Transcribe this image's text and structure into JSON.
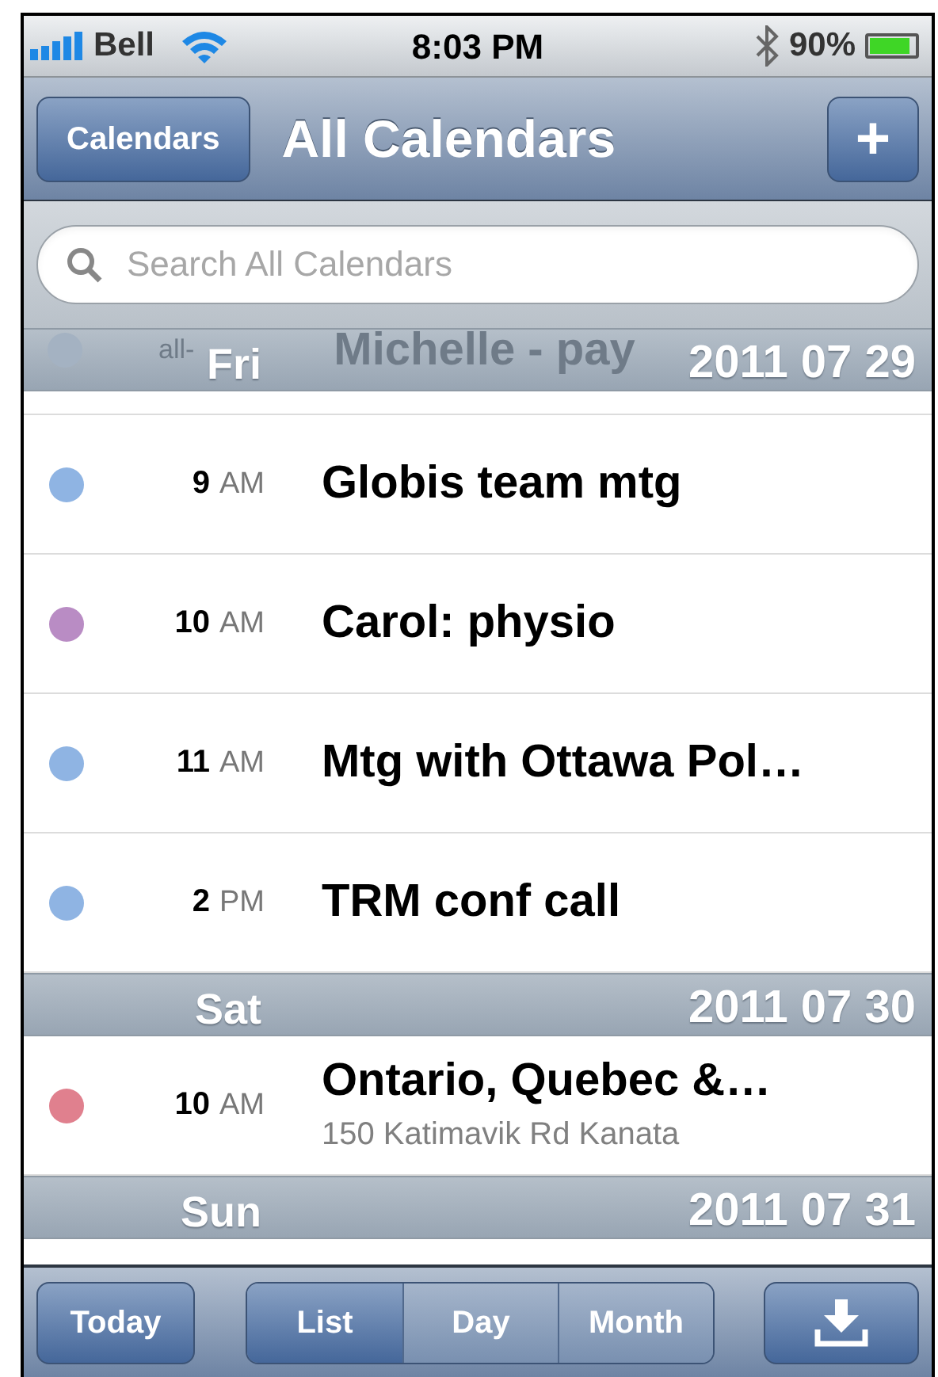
{
  "status_bar": {
    "carrier": "Bell",
    "time": "8:03 PM",
    "battery": "90%"
  },
  "nav_bar": {
    "back_button": "Calendars",
    "title": "All Calendars",
    "add_button": "+"
  },
  "search": {
    "placeholder": "Search All Calendars"
  },
  "sections": [
    {
      "day": "Fri",
      "date": "2011 07 29",
      "partial_event": {
        "time": "all-",
        "title": "Michelle - pay",
        "color": "#a4b2c2"
      },
      "events": [
        {
          "hour": "9",
          "period": "AM",
          "title": "Globis team mtg",
          "color": "#8fb4e3"
        },
        {
          "hour": "10",
          "period": "AM",
          "title": "Carol: physio",
          "color": "#b98cc4"
        },
        {
          "hour": "11",
          "period": "AM",
          "title": "Mtg with Ottawa Pol…",
          "color": "#8fb4e3"
        },
        {
          "hour": "2",
          "period": "PM",
          "title": "TRM conf call",
          "color": "#8fb4e3"
        }
      ]
    },
    {
      "day": "Sat",
      "date": "2011 07 30",
      "events": [
        {
          "hour": "10",
          "period": "AM",
          "title": "Ontario, Quebec &…",
          "location": "150 Katimavik Rd Kanata",
          "color": "#e0808e"
        }
      ]
    },
    {
      "day": "Sun",
      "date": "2011 07 31"
    }
  ],
  "toolbar": {
    "today_button": "Today",
    "segments": [
      {
        "label": "List",
        "selected": true
      },
      {
        "label": "Day",
        "selected": false
      },
      {
        "label": "Month",
        "selected": false
      }
    ]
  }
}
